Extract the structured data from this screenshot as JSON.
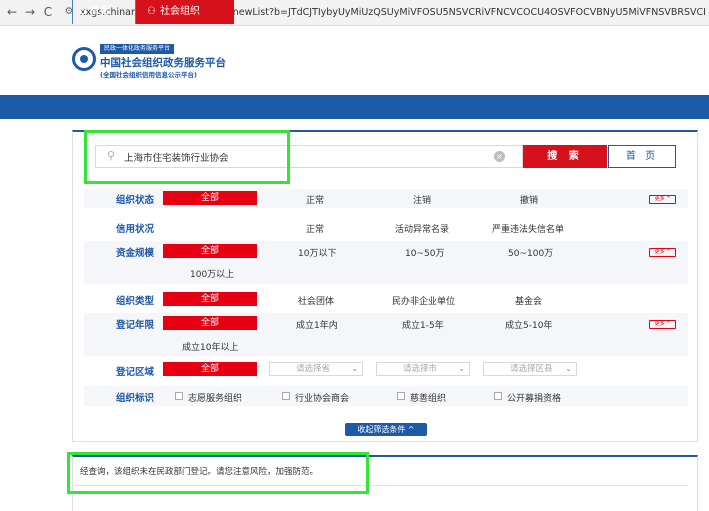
{
  "browser": {
    "back": "←",
    "forward": "→",
    "reload": "C",
    "url": "xxgs.chinanpo.mca.gov.cn/gsxt/newList?b=JTdCJTIybyUyMiUzQSUyMiVFOSU5NSVCRiVFNCVCOCU4OSVFOCVBNyU5MiVFNSVBRSVCNiVFNSVCMSU4NSVFNSU5MyVBQSVFOSU4QiU5NiVFNSVCRCVBQQ"
  },
  "header": {
    "tag": "民政一体化政务服务平台",
    "title": "中国社会组织政务服务平台",
    "subtitle": "(全国社会组织信用信息公示平台)"
  },
  "nav": {
    "home": "首页",
    "org": "社会组织"
  },
  "search": {
    "value": "上海市住宅装饰行业协会",
    "search_label": "搜 索",
    "home_label": "首 页"
  },
  "filters": {
    "status": {
      "label": "组织状态",
      "all": "全部",
      "options": [
        "正常",
        "注销",
        "撤销"
      ],
      "more": "更多 ^"
    },
    "credit": {
      "label": "信用状况",
      "options": [
        "正常",
        "活动异常名录",
        "严重违法失信名单"
      ]
    },
    "capital": {
      "label": "资金规模",
      "all": "全部",
      "options": [
        "10万以下",
        "10~50万",
        "50~100万",
        "100万以上"
      ],
      "more": "更多 ^"
    },
    "type": {
      "label": "组织类型",
      "all": "全部",
      "options": [
        "社会团体",
        "民办非企业单位",
        "基金会"
      ]
    },
    "years": {
      "label": "登记年限",
      "all": "全部",
      "options": [
        "成立1年内",
        "成立1-5年",
        "成立5-10年",
        "成立10年以上"
      ],
      "more": "更多 ^"
    },
    "region": {
      "label": "登记区域",
      "all": "全部",
      "province": "请选择省",
      "city": "请选择市",
      "district": "请选择区县"
    },
    "tags": {
      "label": "组织标识",
      "options": [
        "志愿服务组织",
        "行业协会商会",
        "慈善组织",
        "公开募捐资格"
      ]
    },
    "collapse": "收起筛选条件 ^"
  },
  "result": {
    "message": "经查询，该组织未在民政部门登记。请您注意风险，加强防范。"
  },
  "colors": {
    "brand_blue": "#1e5aa8",
    "accent_red": "#e60012",
    "highlight_green": "#33e633"
  }
}
